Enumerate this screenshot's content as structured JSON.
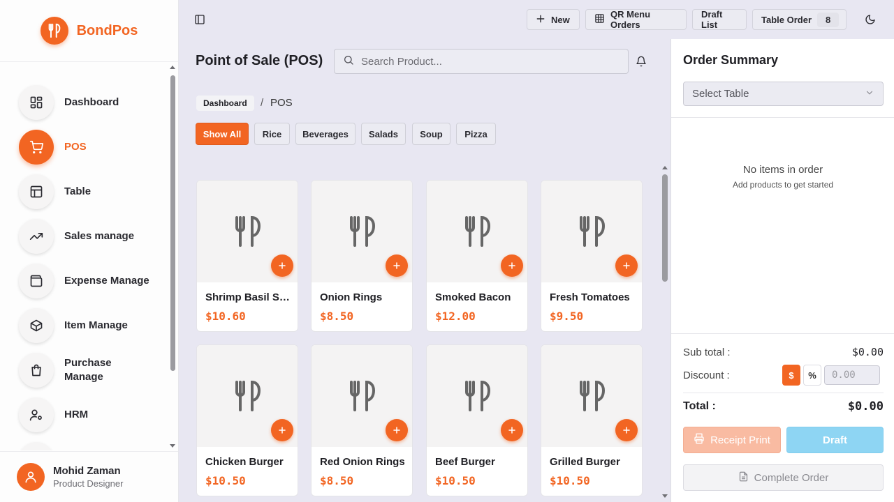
{
  "brand": {
    "name": "BondPos",
    "logo_icon": "utensils-icon",
    "accent": "#f26522"
  },
  "sidebar": {
    "items": [
      {
        "label": "Dashboard",
        "icon": "dashboard-icon"
      },
      {
        "label": "POS",
        "icon": "cart-icon",
        "active": true
      },
      {
        "label": "Table",
        "icon": "table-icon"
      },
      {
        "label": "Sales manage",
        "icon": "trending-up-icon"
      },
      {
        "label": "Expense Manage",
        "icon": "wallet-icon"
      },
      {
        "label": "Item Manage",
        "icon": "box-icon"
      },
      {
        "label": "Purchase Manage",
        "icon": "bag-icon"
      },
      {
        "label": "HRM",
        "icon": "user-gear-icon"
      }
    ]
  },
  "user": {
    "name": "Mohid Zaman",
    "role": "Product Designer"
  },
  "topbar": {
    "new_label": "New",
    "qr_label": "QR Menu Orders",
    "draft_label": "Draft List",
    "table_order_label": "Table Order",
    "table_order_count": "8"
  },
  "main": {
    "title": "Point of Sale (POS)",
    "search_placeholder": "Search Product...",
    "breadcrumb": {
      "home": "Dashboard",
      "separator": "/",
      "current": "POS"
    },
    "categories": [
      "Show All",
      "Rice",
      "Beverages",
      "Salads",
      "Soup",
      "Pizza"
    ],
    "active_category": "Show All",
    "products": [
      {
        "name": "Shrimp Basil Salad",
        "price": "$10.60"
      },
      {
        "name": "Onion Rings",
        "price": "$8.50"
      },
      {
        "name": "Smoked Bacon",
        "price": "$12.00"
      },
      {
        "name": "Fresh Tomatoes",
        "price": "$9.50"
      },
      {
        "name": "Chicken Burger",
        "price": "$10.50"
      },
      {
        "name": "Red Onion Rings",
        "price": "$8.50"
      },
      {
        "name": "Beef Burger",
        "price": "$10.50"
      },
      {
        "name": "Grilled Burger",
        "price": "$10.50"
      }
    ]
  },
  "order": {
    "title": "Order Summary",
    "select_table": "Select Table",
    "empty_title": "No items in order",
    "empty_sub": "Add products to get started",
    "subtotal_label": "Sub total :",
    "subtotal_value": "$0.00",
    "discount_label": "Discount :",
    "discount_fixed": "$",
    "discount_percent": "%",
    "discount_placeholder": "0.00",
    "total_label": "Total :",
    "total_value": "$0.00",
    "receipt_label": "Receipt Print",
    "draft_label": "Draft",
    "complete_label": "Complete Order"
  }
}
